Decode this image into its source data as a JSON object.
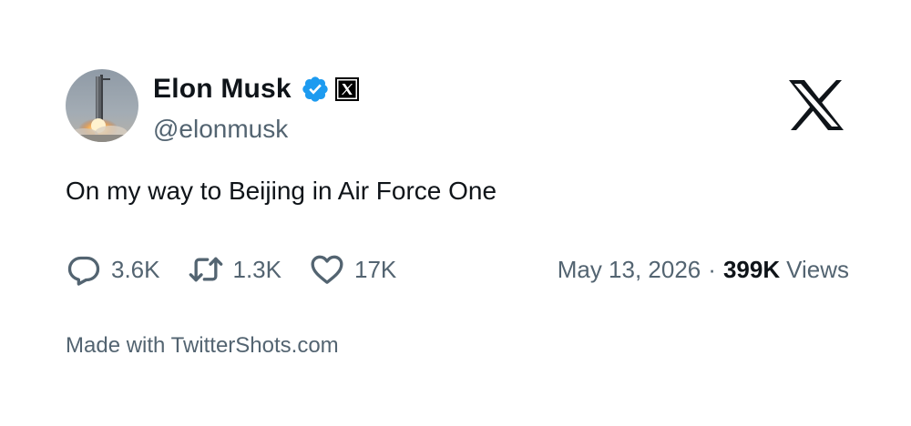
{
  "author": {
    "display_name": "Elon Musk",
    "handle": "@elonmusk",
    "avatar_icon": "rocket-launch-photo",
    "verified_icon": "verified-badge-icon",
    "verified_color": "#1d9bf0",
    "affiliation_icon": "x-affiliation-icon"
  },
  "brand": {
    "logo_icon": "x-logo-icon"
  },
  "tweet": {
    "text": "On my way to Beijing in Air Force One"
  },
  "stats": {
    "replies": "3.6K",
    "reposts": "1.3K",
    "likes": "17K"
  },
  "meta": {
    "date": "May 13, 2026",
    "separator": "·",
    "views_count": "399K",
    "views_label": "Views"
  },
  "footer": {
    "text": "Made with TwitterShots.com"
  },
  "colors": {
    "text_primary": "#0f1419",
    "text_secondary": "#536471",
    "background": "#ffffff"
  }
}
